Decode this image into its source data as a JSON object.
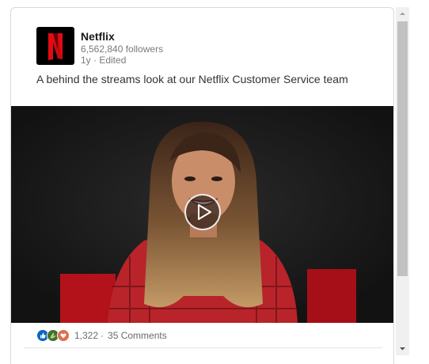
{
  "post": {
    "company_name": "Netflix",
    "followers": "6,562,840 followers",
    "time": "1y · Edited",
    "text": "A behind the streams look at our Netflix Customer Service team",
    "logo_letter_color": "#e50914",
    "logo_background": "#000000"
  },
  "video": {
    "play_icon": "play-icon"
  },
  "social": {
    "reactions": [
      "like-icon",
      "celebrate-icon",
      "love-icon"
    ],
    "reaction_colors": [
      "#0a66c2",
      "#44712e",
      "#df704d"
    ],
    "count": "1,322",
    "separator": "·",
    "comments": "35 Comments"
  },
  "scrollbar": {
    "up_icon": "arrow-up-icon",
    "down_icon": "arrow-down-icon"
  }
}
